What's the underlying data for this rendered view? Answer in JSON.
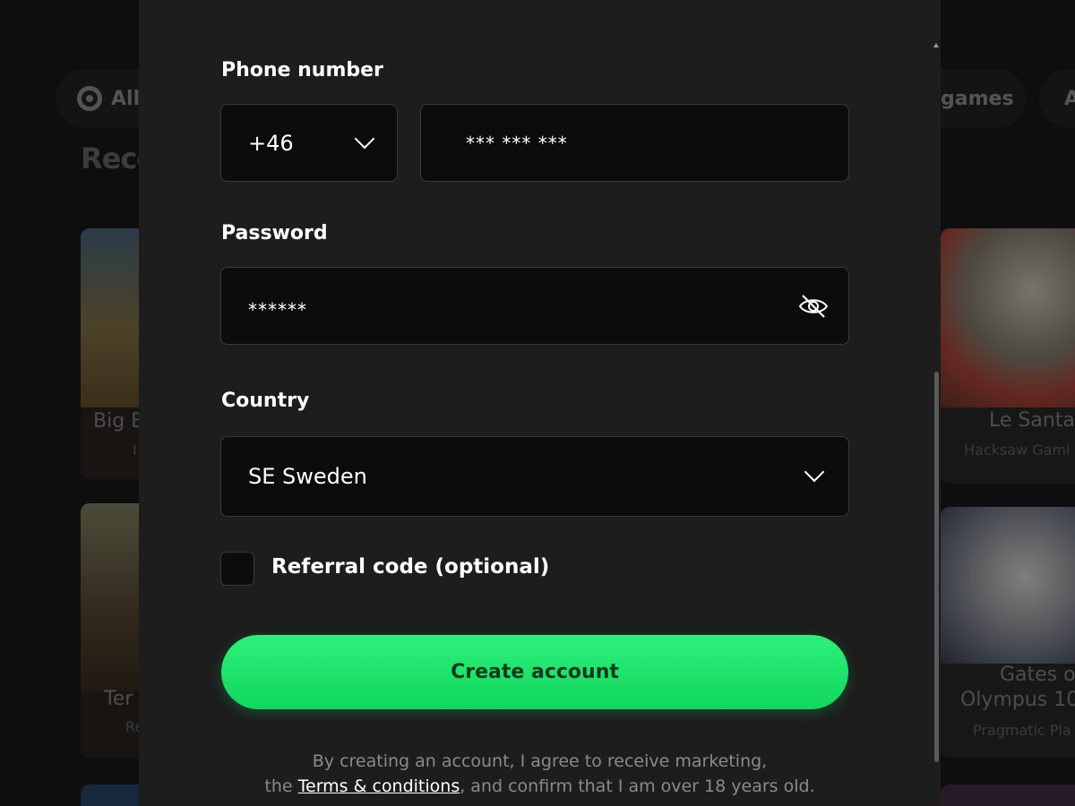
{
  "background": {
    "filter_pills": [
      {
        "label": "All"
      },
      {
        "label": "games"
      },
      {
        "label": "A"
      }
    ],
    "section_heading": "Rece",
    "cards_left": [
      {
        "title": "Big B",
        "provider": "I"
      },
      {
        "title": "Ter",
        "provider": "Re"
      }
    ],
    "cards_right": [
      {
        "title": "Le Santa",
        "provider": "Hacksaw Gami"
      },
      {
        "title": "Gates of",
        "title_line2": "Olympus 10",
        "provider": "Pragmatic Pla"
      }
    ]
  },
  "form": {
    "phone": {
      "label": "Phone number",
      "country_code": "+46",
      "value": "*** *** ***"
    },
    "password": {
      "label": "Password",
      "value": "******"
    },
    "country": {
      "label": "Country",
      "value": "SE Sweden"
    },
    "referral": {
      "label": "Referral code (optional)",
      "checked": false
    },
    "submit_label": "Create account",
    "disclaimer": {
      "line1": "By creating an account, I agree to receive marketing,",
      "line2_prefix": "the",
      "terms_link": "Terms & conditions",
      "line2_suffix": ", and confirm that I am over 18 years old."
    }
  },
  "colors": {
    "modal_bg": "#1d1d1d",
    "field_bg": "#0c0c0c",
    "accent_green": "#1ae56a"
  },
  "icons": {
    "country_code_dropdown": "chevron-down-icon",
    "password_toggle": "eye-off-icon",
    "country_dropdown": "chevron-down-icon",
    "all_pill": "target-icon"
  }
}
